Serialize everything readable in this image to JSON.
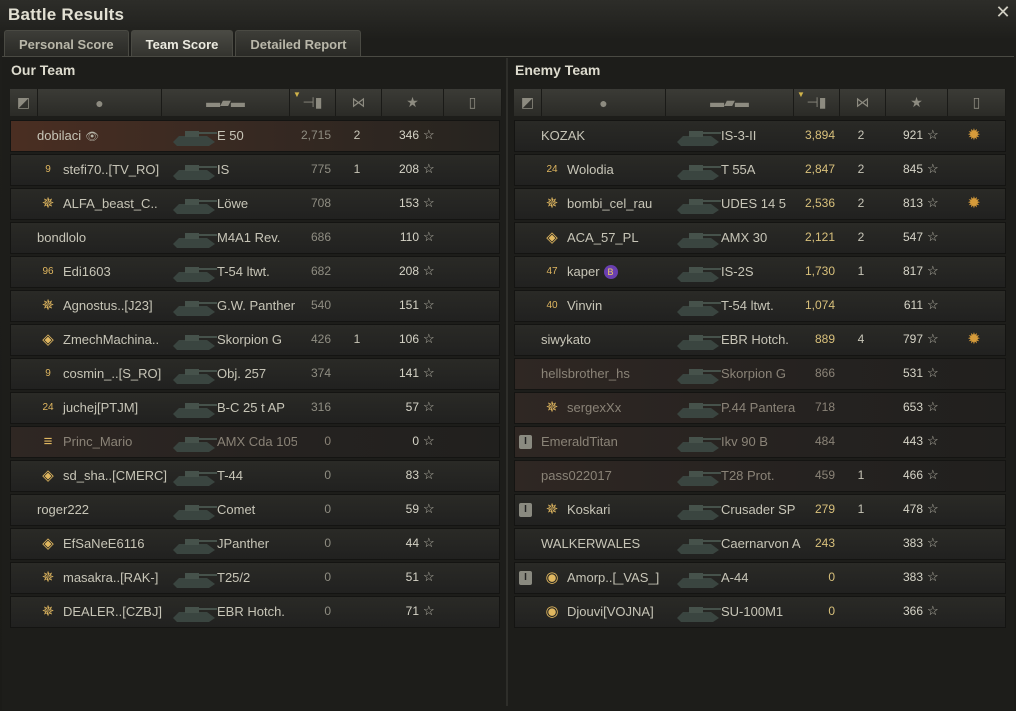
{
  "window": {
    "title": "Battle Results",
    "close_label": "✕"
  },
  "tabs": [
    {
      "label": "Personal Score",
      "active": false
    },
    {
      "label": "Team Score",
      "active": true
    },
    {
      "label": "Detailed Report",
      "active": false
    }
  ],
  "column_icons": [
    "squad-icon",
    "player-icon",
    "tank-icon",
    "damage-icon",
    "kills-icon",
    "xp-star-icon",
    "medal-icon"
  ],
  "our_team": {
    "title": "Our Team",
    "rows": [
      {
        "name": "dobilaci",
        "tank": "E 50",
        "damage": "2,715",
        "kills": "2",
        "xp": "346",
        "platoon": "",
        "badge": "",
        "mine": true,
        "dead": false,
        "eye": true
      },
      {
        "name": "stefi70..[TV_RO]",
        "tank": "IS",
        "damage": "775",
        "kills": "1",
        "xp": "208",
        "platoon": "",
        "badge": "9",
        "dead": false
      },
      {
        "name": "ALFA_beast_C..",
        "tank": "Löwe",
        "damage": "708",
        "kills": "",
        "xp": "153",
        "platoon": "",
        "badge": "✵",
        "dead": false
      },
      {
        "name": "bondlolo",
        "tank": "M4A1 Rev.",
        "damage": "686",
        "kills": "",
        "xp": "110",
        "platoon": "",
        "badge": "",
        "dead": false
      },
      {
        "name": "Edi1603",
        "tank": "T-54 ltwt.",
        "damage": "682",
        "kills": "",
        "xp": "208",
        "platoon": "",
        "badge": "96",
        "dead": false
      },
      {
        "name": "Agnostus..[J23]",
        "tank": "G.W. Panther",
        "damage": "540",
        "kills": "",
        "xp": "151",
        "platoon": "",
        "badge": "✵",
        "dead": false
      },
      {
        "name": "ZmechMachina..",
        "tank": "Skorpion G",
        "damage": "426",
        "kills": "1",
        "xp": "106",
        "platoon": "",
        "badge": "◈",
        "dead": false
      },
      {
        "name": "cosmin_..[S_RO]",
        "tank": "Obj. 257",
        "damage": "374",
        "kills": "",
        "xp": "141",
        "platoon": "",
        "badge": "9",
        "dead": false
      },
      {
        "name": "juchej[PTJM]",
        "tank": "B-C 25 t AP",
        "damage": "316",
        "kills": "",
        "xp": "57",
        "platoon": "",
        "badge": "24",
        "dead": false
      },
      {
        "name": "Princ_Mario",
        "tank": "AMX Cda 105",
        "damage": "0",
        "kills": "",
        "xp": "0",
        "platoon": "",
        "badge": "≡",
        "dead": true
      },
      {
        "name": "sd_sha..[CMERC]",
        "tank": "T-44",
        "damage": "0",
        "kills": "",
        "xp": "83",
        "platoon": "",
        "badge": "◈",
        "dead": false
      },
      {
        "name": "roger222",
        "tank": "Comet",
        "damage": "0",
        "kills": "",
        "xp": "59",
        "platoon": "",
        "badge": "",
        "dead": false
      },
      {
        "name": "EfSaNeE6116",
        "tank": "JPanther",
        "damage": "0",
        "kills": "",
        "xp": "44",
        "platoon": "",
        "badge": "◈",
        "dead": false
      },
      {
        "name": "masakra..[RAK-]",
        "tank": "T25/2",
        "damage": "0",
        "kills": "",
        "xp": "51",
        "platoon": "",
        "badge": "✵",
        "dead": false
      },
      {
        "name": "DEALER..[CZBJ]",
        "tank": "EBR Hotch.",
        "damage": "0",
        "kills": "",
        "xp": "71",
        "platoon": "",
        "badge": "✵",
        "dead": false
      }
    ]
  },
  "enemy_team": {
    "title": "Enemy Team",
    "rows": [
      {
        "name": "KOZAK",
        "tank": "IS-3-II",
        "damage": "3,894",
        "kills": "2",
        "xp": "921",
        "platoon": "",
        "badge": "",
        "medal": true,
        "dead": false
      },
      {
        "name": "Wolodia",
        "tank": "T 55A",
        "damage": "2,847",
        "kills": "2",
        "xp": "845",
        "platoon": "",
        "badge": "24",
        "medal": false,
        "dead": false
      },
      {
        "name": "bombi_cel_rau",
        "tank": "UDES 14 5",
        "damage": "2,536",
        "kills": "2",
        "xp": "813",
        "platoon": "",
        "badge": "✵",
        "medal": true,
        "dead": false
      },
      {
        "name": "ACA_57_PL",
        "tank": "AMX 30",
        "damage": "2,121",
        "kills": "2",
        "xp": "547",
        "platoon": "",
        "badge": "◈",
        "medal": false,
        "dead": false
      },
      {
        "name": "kaper",
        "tank": "IS-2S",
        "damage": "1,730",
        "kills": "1",
        "xp": "817",
        "platoon": "",
        "badge": "47",
        "medal": false,
        "dead": false,
        "clan": "B"
      },
      {
        "name": "Vinvin",
        "tank": "T-54 ltwt.",
        "damage": "1,074",
        "kills": "",
        "xp": "611",
        "platoon": "",
        "badge": "40",
        "medal": false,
        "dead": false
      },
      {
        "name": "siwykato",
        "tank": "EBR Hotch.",
        "damage": "889",
        "kills": "4",
        "xp": "797",
        "platoon": "",
        "badge": "",
        "medal": true,
        "dead": false
      },
      {
        "name": "hellsbrother_hs",
        "tank": "Skorpion G",
        "damage": "866",
        "kills": "",
        "xp": "531",
        "platoon": "",
        "badge": "",
        "medal": false,
        "dead": true
      },
      {
        "name": "sergexXx",
        "tank": "P.44 Pantera",
        "damage": "718",
        "kills": "",
        "xp": "653",
        "platoon": "",
        "badge": "✵",
        "medal": false,
        "dead": true
      },
      {
        "name": "EmeraldTitan",
        "tank": "Ikv 90 B",
        "damage": "484",
        "kills": "",
        "xp": "443",
        "platoon": "I",
        "badge": "",
        "medal": false,
        "dead": true
      },
      {
        "name": "pass022017",
        "tank": "T28 Prot.",
        "damage": "459",
        "kills": "1",
        "xp": "466",
        "platoon": "",
        "badge": "",
        "medal": false,
        "dead": true
      },
      {
        "name": "Koskari",
        "tank": "Crusader SP",
        "damage": "279",
        "kills": "1",
        "xp": "478",
        "platoon": "I",
        "badge": "✵",
        "medal": false,
        "dead": false
      },
      {
        "name": "WALKERWALES",
        "tank": "Caernarvon A",
        "damage": "243",
        "kills": "",
        "xp": "383",
        "platoon": "",
        "badge": "",
        "medal": false,
        "dead": false
      },
      {
        "name": "Amorp..[_VAS_]",
        "tank": "A-44",
        "damage": "0",
        "kills": "",
        "xp": "383",
        "platoon": "I",
        "badge": "◉",
        "medal": false,
        "dead": false
      },
      {
        "name": "Djouvi[VOJNA]",
        "tank": "SU-100M1",
        "damage": "0",
        "kills": "",
        "xp": "366",
        "platoon": "",
        "badge": "◉",
        "medal": false,
        "dead": false
      }
    ]
  },
  "colors": {
    "accent": "#d0b34a",
    "medal": "#d69b3a",
    "clan": "#6a3fb0"
  }
}
